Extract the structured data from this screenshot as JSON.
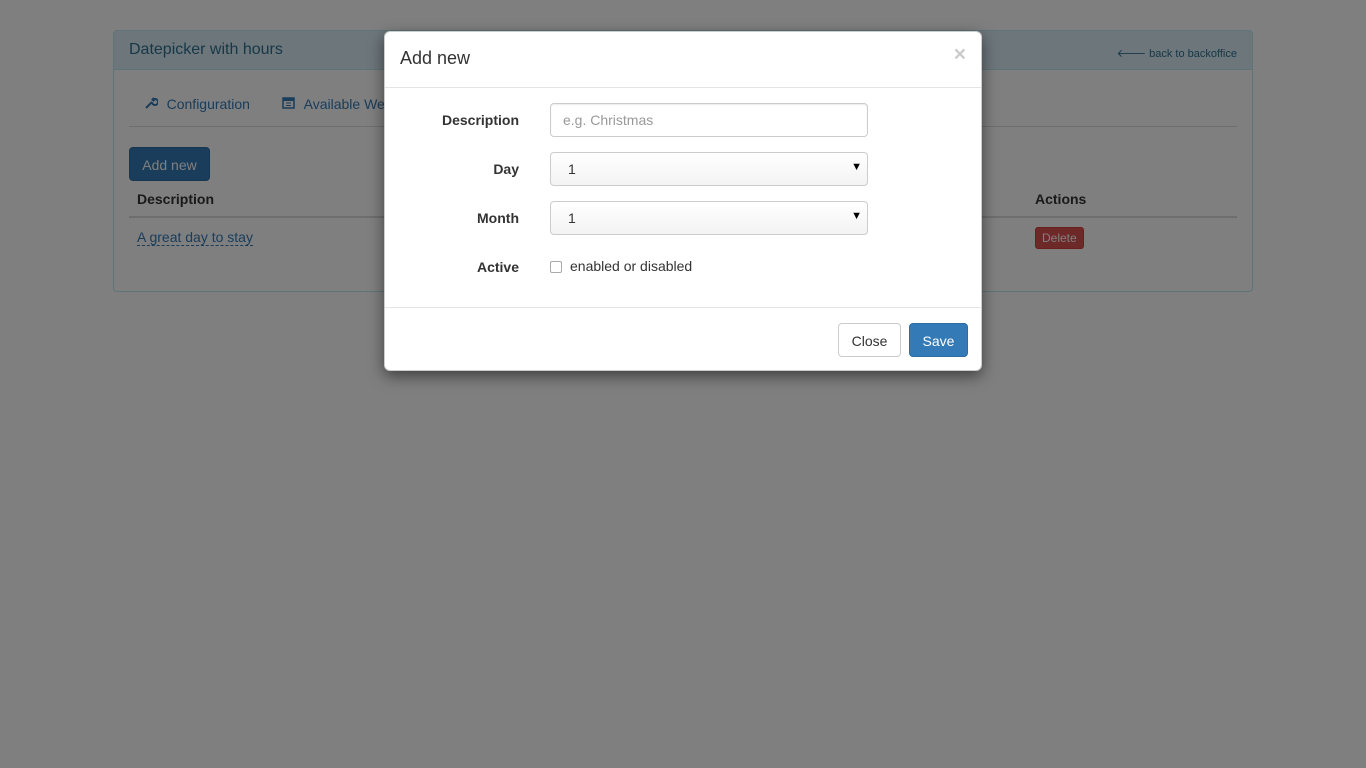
{
  "panel": {
    "title": "Datepicker with hours",
    "back_link": "back to backoffice",
    "back_icon": "arrow-left-icon"
  },
  "tabs": [
    {
      "label": "Configuration",
      "icon": "wrench-icon"
    },
    {
      "label": "Available Wee",
      "icon": "calendar-icon"
    }
  ],
  "toolbar": {
    "add_new_label": "Add new"
  },
  "table": {
    "columns": [
      "Description",
      "Actions"
    ],
    "rows": [
      {
        "description": "A great day to stay",
        "action": "Delete"
      }
    ]
  },
  "modal": {
    "title": "Add new",
    "close_symbol": "×",
    "fields": {
      "description": {
        "label": "Description",
        "placeholder": "e.g. Christmas",
        "value": ""
      },
      "day": {
        "label": "Day",
        "value": "1"
      },
      "month": {
        "label": "Month",
        "value": "1"
      },
      "active": {
        "label": "Active",
        "checkbox_label": "enabled or disabled",
        "checked": false
      }
    },
    "footer": {
      "close_label": "Close",
      "save_label": "Save"
    }
  },
  "colors": {
    "primary": "#337ab7",
    "danger": "#d9534f",
    "panel_heading": "#d9edf7",
    "panel_title": "#31708f"
  }
}
